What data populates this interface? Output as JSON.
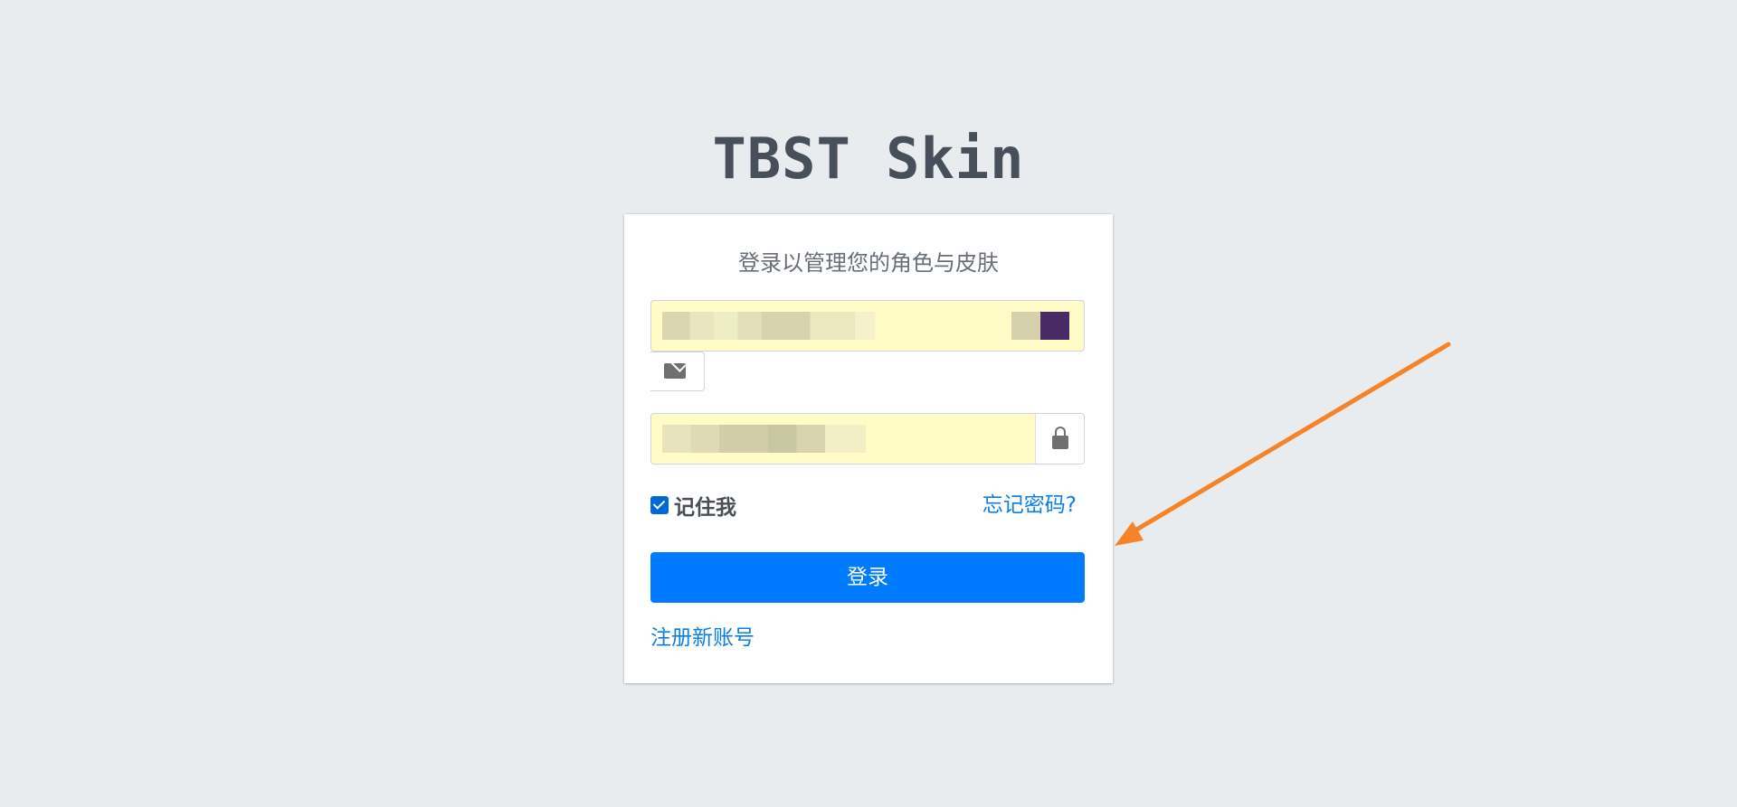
{
  "brand": {
    "title": "TBST Skin"
  },
  "login_card": {
    "subtitle": "登录以管理您的角色与皮肤",
    "email": {
      "icon": "envelope-icon"
    },
    "password": {
      "icon": "lock-icon"
    },
    "remember": {
      "label": "记住我",
      "checked": true
    },
    "forgot_link": "忘记密码?",
    "login_button": "登录",
    "register_link": "注册新账号"
  },
  "annotation": {
    "arrow_color": "#f5832a"
  },
  "colors": {
    "background": "#e9ecef",
    "primary": "#007bff",
    "link": "#0b7fe8",
    "autofill": "#fffcc8"
  }
}
